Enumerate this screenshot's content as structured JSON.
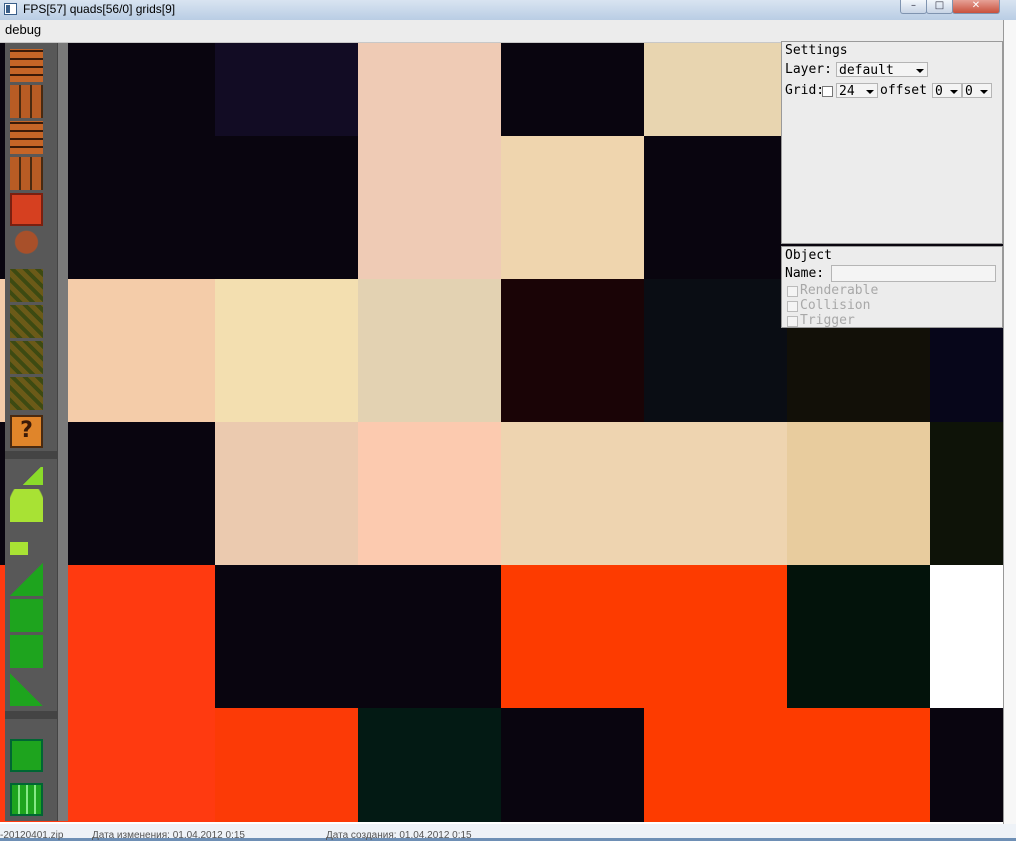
{
  "window": {
    "title": "FPS[57] quads[56/0] grids[9]",
    "min_label": "",
    "max_label": "",
    "close_label": "✕"
  },
  "menu": {
    "debug_label": "debug"
  },
  "palette": {
    "tiles": [
      "door-block",
      "brick-wall",
      "door-block-2",
      "brick-block",
      "red-block",
      "goomba",
      "moss-block",
      "moss-block-2",
      "moss-block-3",
      "moss-block-4",
      "question-block",
      "green-slope-top",
      "green-hill",
      "green-grass",
      "green-slope",
      "green-block-door",
      "green-block",
      "green-triangle",
      "green-pipe-top",
      "green-pipe"
    ],
    "question_mark": "?"
  },
  "settings": {
    "title": "Settings",
    "layer_label": "Layer:",
    "layer_value": "default",
    "grid_label": "Grid:",
    "grid_value": "24",
    "offset_label": "offset",
    "offset_x": "0",
    "offset_y": "0",
    "grid_checked": false
  },
  "object": {
    "title": "Object",
    "name_label": "Name:",
    "name_value": "",
    "renderable_label": "Renderable",
    "collision_label": "Collision",
    "trigger_label": "Trigger"
  },
  "scene_colors": [
    [
      "#09050f",
      "#120c24",
      "#efcbb5",
      "#09050f",
      "#e8d5b0",
      "#e8d5b0",
      "#e8d5b0"
    ],
    [
      "#09050f",
      "#09050f",
      "#efcbb5",
      "#efd5ae",
      "#09050f",
      "#09050f",
      "#09050f"
    ],
    [
      "#f4cca9",
      "#f3dfb0",
      "#e3d2b2",
      "#1a0406",
      "#0a0d14",
      "#121008",
      "#07061a"
    ],
    [
      "#09050f",
      "#ebcaaf",
      "#fccaaf",
      "#eed4b0",
      "#eed4b0",
      "#e8cc9e",
      "#0e1308"
    ],
    [
      "#ff3a10",
      "#09050f",
      "#09050f",
      "#fd3b00",
      "#fd3b00",
      "#03130b",
      "#ffffff"
    ],
    [
      "#ff3a10",
      "#fc3a06",
      "#031a14",
      "#09050f",
      "#fd3b00",
      "#fd3b00",
      "#09050f"
    ]
  ],
  "status": {
    "file_name": "-20120401.zip",
    "modified": "Дата изменения: 01.04.2012 0:15",
    "created": "Дата создания: 01.04.2012 0:15"
  }
}
